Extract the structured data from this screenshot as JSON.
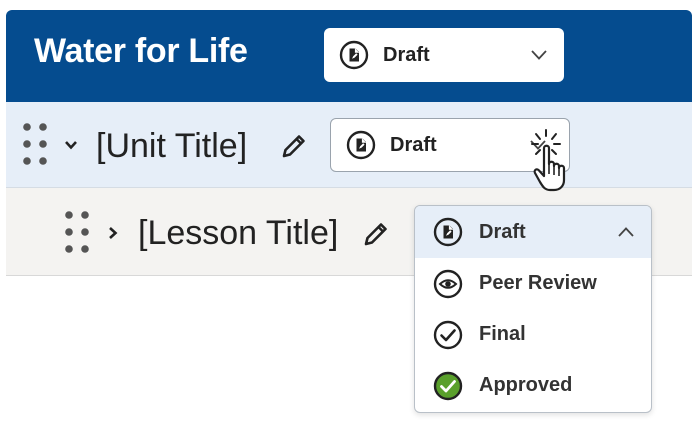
{
  "header": {
    "title": "Water for Life",
    "status": {
      "label": "Draft",
      "icon": "draft-document-icon"
    },
    "background": "#054c8f"
  },
  "unit": {
    "title": "[Unit Title]",
    "expanded": true,
    "status": {
      "label": "Draft",
      "icon": "draft-document-icon"
    }
  },
  "lesson": {
    "title": "[Lesson Title]",
    "expanded": false,
    "status": {
      "label": "Draft",
      "icon": "draft-document-icon",
      "open": true
    }
  },
  "dropdown": {
    "options": [
      {
        "label": "Draft",
        "icon": "draft-document-icon",
        "selected": true
      },
      {
        "label": "Peer Review",
        "icon": "eye-icon",
        "selected": false
      },
      {
        "label": "Final",
        "icon": "check-circle-icon",
        "selected": false
      },
      {
        "label": "Approved",
        "icon": "approved-check-icon",
        "color": "#5aa02c",
        "selected": false
      }
    ]
  },
  "colors": {
    "brand_blue": "#054c8f",
    "unit_row_bg": "#e6eef8",
    "lesson_row_bg": "#f4f3f1",
    "approved_green": "#5aa02c"
  }
}
